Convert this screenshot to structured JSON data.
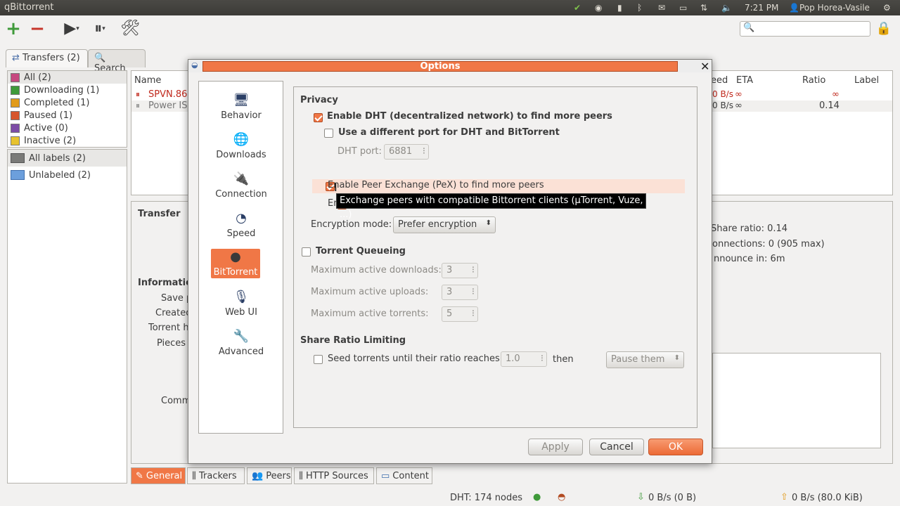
{
  "topbar": {
    "app_title": "qBittorrent",
    "time": "7:21 PM",
    "user": "Pop Horea-Vasile"
  },
  "tabs": {
    "transfers": "Transfers (2)",
    "search": "Search"
  },
  "status_filters": [
    {
      "label": "All (2)",
      "color": "#c6487f"
    },
    {
      "label": "Downloading (1)",
      "color": "#3f9a3a"
    },
    {
      "label": "Completed (1)",
      "color": "#e19b1b"
    },
    {
      "label": "Paused (1)",
      "color": "#d6562d"
    },
    {
      "label": "Active (0)",
      "color": "#7c4ca6"
    },
    {
      "label": "Inactive (2)",
      "color": "#e7c22e"
    }
  ],
  "labels": {
    "all": "All labels (2)",
    "unlabeled": "Unlabeled (2)"
  },
  "list": {
    "columns": {
      "name": "Name",
      "speed": "eed",
      "eta": "ETA",
      "ratio": "Ratio",
      "label": "Label"
    },
    "rows": [
      {
        "name": "SPVN.86.",
        "speed": "0 B/s",
        "eta": "∞",
        "ratio": "∞"
      },
      {
        "name": "Power IS",
        "speed": "0 B/s",
        "eta": "∞",
        "ratio": "0.14"
      }
    ]
  },
  "details": {
    "transfer_heading": "Transfer",
    "information_heading": "Informatio",
    "save_path": "Save p",
    "created": "Created",
    "torrent_hash": "Torrent h",
    "pieces": "Pieces",
    "comment": "Comm",
    "share_ratio": "Share ratio: 0.14",
    "connections": "onnections: 0 (905 max)",
    "reannounce": "nnounce in: 6m"
  },
  "bottom_tabs": [
    "General",
    "Trackers",
    "Peers",
    "HTTP Sources",
    "Content"
  ],
  "statusbar": {
    "dht": "DHT: 174 nodes",
    "down": "0 B/s (0 B)",
    "up": "0 B/s (80.0 KiB)"
  },
  "dialog": {
    "title": "Options",
    "nav": [
      "Behavior",
      "Downloads",
      "Connection",
      "Speed",
      "BitTorrent",
      "Web UI",
      "Advanced"
    ],
    "privacy": {
      "heading": "Privacy",
      "dht": "Enable DHT (decentralized network) to find more peers",
      "diff_port": "Use a different port for DHT and BitTorrent",
      "dht_port_label": "DHT port:",
      "dht_port_value": "6881",
      "pex": "Enable Peer Exchange (PeX) to find more peers",
      "encryption_partial": "En",
      "encryption_mode_label": "Encryption mode:",
      "encryption_mode_value": "Prefer encryption"
    },
    "tooltip": "Exchange peers with compatible Bittorrent clients (µTorrent, Vuze, ...)",
    "queueing": {
      "heading": "Torrent Queueing",
      "max_downloads_label": "Maximum active downloads:",
      "max_downloads": "3",
      "max_uploads_label": "Maximum active uploads:",
      "max_uploads": "3",
      "max_torrents_label": "Maximum active torrents:",
      "max_torrents": "5"
    },
    "share_ratio": {
      "heading": "Share Ratio Limiting",
      "seed_label": "Seed torrents until their ratio reaches",
      "ratio_value": "1.0",
      "then": "then",
      "action": "Pause them"
    },
    "buttons": {
      "apply": "Apply",
      "cancel": "Cancel",
      "ok": "OK"
    }
  }
}
